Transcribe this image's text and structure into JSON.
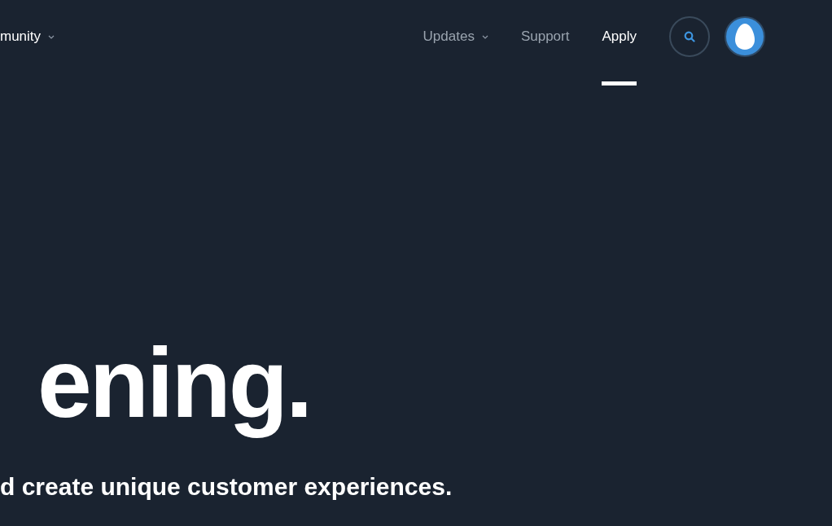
{
  "nav": {
    "left_items": [
      {
        "label": "munity",
        "dropdown": true
      }
    ],
    "items": [
      {
        "label": "Updates",
        "dropdown": true,
        "selected": false
      },
      {
        "label": "Support",
        "dropdown": false,
        "selected": false
      },
      {
        "label": "Apply",
        "dropdown": false,
        "selected": true
      }
    ]
  },
  "hero": {
    "headline": "ening.",
    "subtitle": "d create unique customer experiences."
  }
}
